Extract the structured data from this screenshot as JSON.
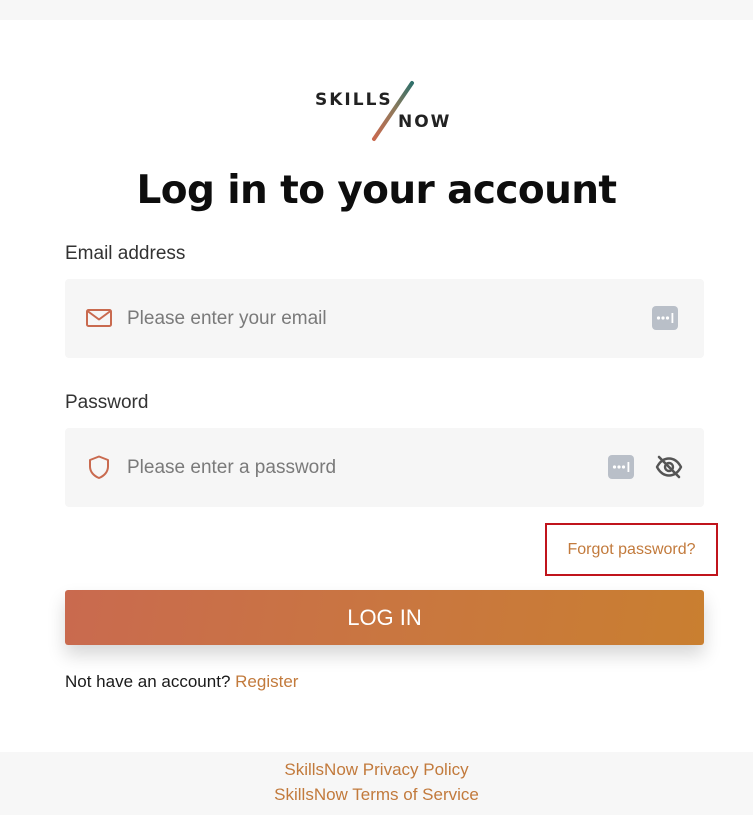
{
  "logo": {
    "top_word": "SKILLS",
    "bottom_word": "NOW"
  },
  "page": {
    "title": "Log in to your account"
  },
  "email": {
    "label": "Email address",
    "placeholder": "Please enter your email",
    "value": "",
    "icon": "mail-icon",
    "password_manager_icon": "password-manager-icon"
  },
  "password": {
    "label": "Password",
    "placeholder": "Please enter a password",
    "value": "",
    "icon": "shield-icon",
    "password_manager_icon": "password-manager-icon",
    "visibility_icon": "eye-off-icon"
  },
  "forgot": {
    "label": "Forgot password?"
  },
  "login": {
    "label": "LOG IN"
  },
  "register": {
    "prompt": "Not have an account?",
    "link_label": "Register"
  },
  "footer": {
    "privacy": "SkillsNow Privacy Policy",
    "terms": "SkillsNow Terms of Service"
  },
  "colors": {
    "accent": "#c27a3c",
    "button_gradient_start": "#c96a4f",
    "button_gradient_end": "#c97f30",
    "highlight_border": "#c0141c",
    "field_background": "#f6f6f6"
  }
}
